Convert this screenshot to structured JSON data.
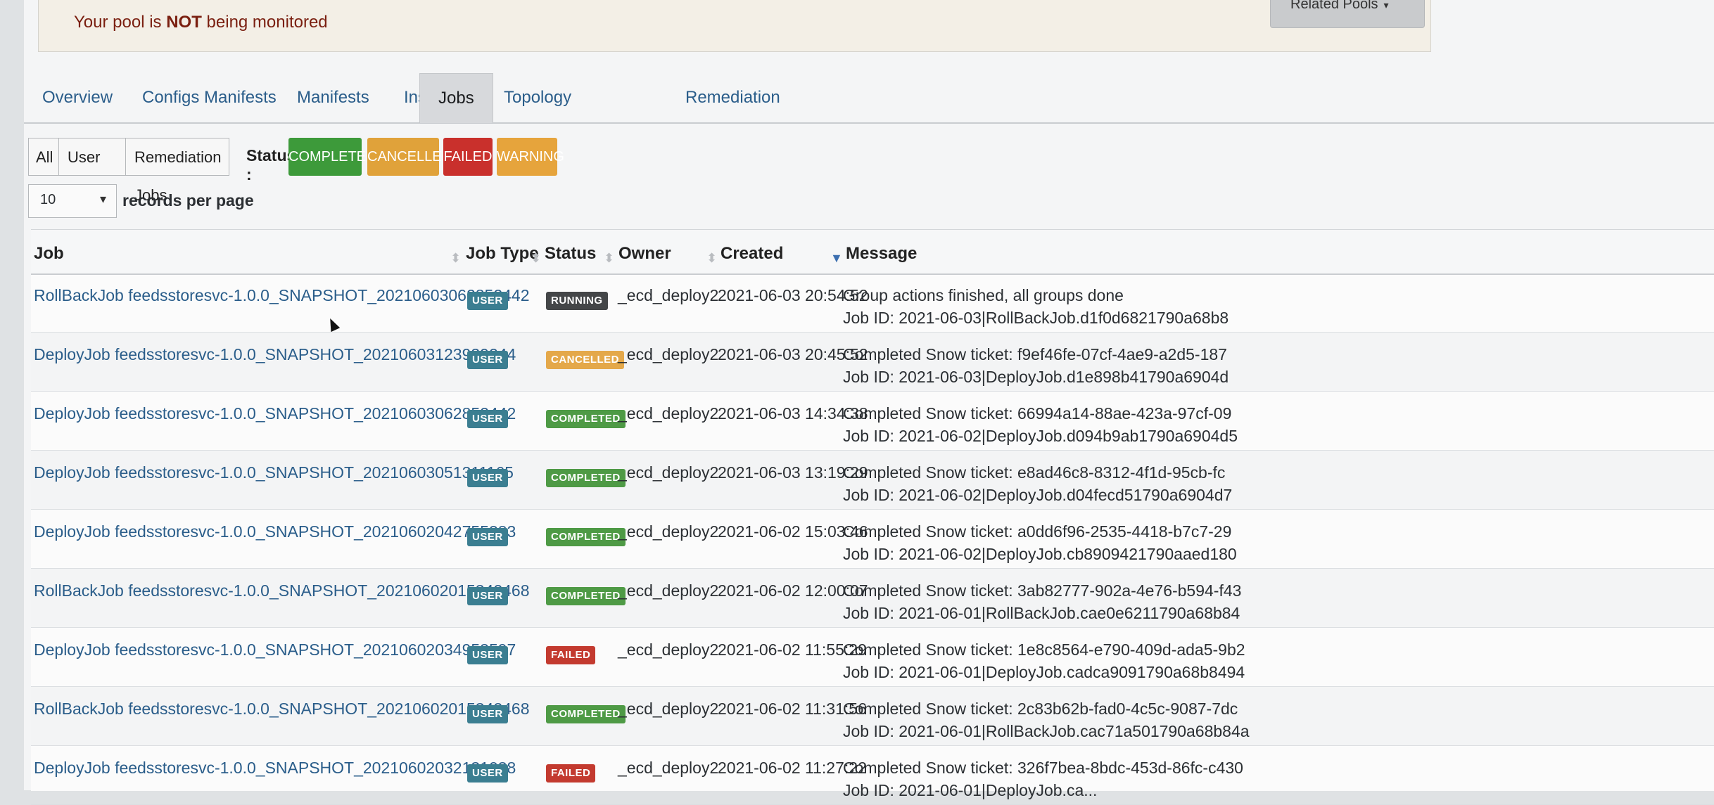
{
  "alert": {
    "prefix": "Your pool is ",
    "strong": "NOT",
    "suffix": " being monitored"
  },
  "related_pools": {
    "label": "Related Pools"
  },
  "tabs": [
    {
      "label": "Overview"
    },
    {
      "label": "Configs Manifests"
    },
    {
      "label": "Manifests"
    },
    {
      "label": "Instances"
    },
    {
      "label": "Topology"
    },
    {
      "label": "Jobs",
      "active": true
    },
    {
      "label": "Remediation"
    }
  ],
  "filters": {
    "all": "All",
    "user_jobs": "User Jobs",
    "remediation_jobs": "Remediation Jobs",
    "status_label": "Status :",
    "statuses": [
      {
        "label": "COMPLETED",
        "color": "#3d9a3a"
      },
      {
        "label": "CANCELLED",
        "color": "#e0a23a"
      },
      {
        "label": "FAILED",
        "color": "#c9302c"
      },
      {
        "label": "WARNING",
        "color": "#e6a43c"
      }
    ]
  },
  "pager": {
    "value": "10",
    "label": "records per page"
  },
  "table": {
    "headers": {
      "job": "Job",
      "job_type": "Job Type",
      "status": "Status",
      "owner": "Owner",
      "created": "Created",
      "message": "Message"
    },
    "badge_colors": {
      "USER": "#3b7e91",
      "RUNNING": "#444648",
      "CANCELLED": "#e4a84a",
      "COMPLETED": "#4e9a45",
      "FAILED": "#c33a2f"
    },
    "rows": [
      {
        "job": "RollBackJob feedsstoresvc-1.0.0_SNAPSHOT_20210603062852442",
        "type": "USER",
        "status": "RUNNING",
        "owner": "_ecd_deploy2",
        "created": "2021-06-03 20:54:52",
        "msg1": "Group actions finished, all groups done",
        "msg2": "Job ID: 2021-06-03|RollBackJob.d1f0d6821790a68b8"
      },
      {
        "job": "DeployJob feedsstoresvc-1.0.0_SNAPSHOT_20210603123939244",
        "type": "USER",
        "status": "CANCELLED",
        "owner": "_ecd_deploy2",
        "created": "2021-06-03 20:45:52",
        "msg1": "Completed Snow ticket: f9ef46fe-07cf-4ae9-a2d5-187",
        "msg2": "Job ID: 2021-06-03|DeployJob.d1e898b41790a6904d"
      },
      {
        "job": "DeployJob feedsstoresvc-1.0.0_SNAPSHOT_20210603062852442",
        "type": "USER",
        "status": "COMPLETED",
        "owner": "_ecd_deploy2",
        "created": "2021-06-03 14:34:38",
        "msg1": "Completed Snow ticket: 66994a14-88ae-423a-97cf-09",
        "msg2": "Job ID: 2021-06-02|DeployJob.d094b9ab1790a6904d5"
      },
      {
        "job": "DeployJob feedsstoresvc-1.0.0_SNAPSHOT_20210603051311165",
        "type": "USER",
        "status": "COMPLETED",
        "owner": "_ecd_deploy2",
        "created": "2021-06-03 13:19:29",
        "msg1": "Completed Snow ticket: e8ad46c8-8312-4f1d-95cb-fc",
        "msg2": "Job ID: 2021-06-02|DeployJob.d04fecd51790a6904d7"
      },
      {
        "job": "DeployJob feedsstoresvc-1.0.0_SNAPSHOT_20210602042755383",
        "type": "USER",
        "status": "COMPLETED",
        "owner": "_ecd_deploy2",
        "created": "2021-06-02 15:03:46",
        "msg1": "Completed Snow ticket: a0dd6f96-2535-4418-b7c7-29",
        "msg2": "Job ID: 2021-06-02|DeployJob.cb8909421790aaed180"
      },
      {
        "job": "RollBackJob feedsstoresvc-1.0.0_SNAPSHOT_20210602015342468",
        "type": "USER",
        "status": "COMPLETED",
        "owner": "_ecd_deploy2",
        "created": "2021-06-02 12:00:07",
        "msg1": "Completed Snow ticket: 3ab82777-902a-4e76-b594-f43",
        "msg2": "Job ID: 2021-06-01|RollBackJob.cae0e6211790a68b84"
      },
      {
        "job": "DeployJob feedsstoresvc-1.0.0_SNAPSHOT_20210602034953597",
        "type": "USER",
        "status": "FAILED",
        "owner": "_ecd_deploy2",
        "created": "2021-06-02 11:55:29",
        "msg1": "Completed Snow ticket: 1e8c8564-e790-409d-ada5-9b2",
        "msg2": "Job ID: 2021-06-01|DeployJob.cadca9091790a68b8494"
      },
      {
        "job": "RollBackJob feedsstoresvc-1.0.0_SNAPSHOT_20210602015342468",
        "type": "USER",
        "status": "COMPLETED",
        "owner": "_ecd_deploy2",
        "created": "2021-06-02 11:31:56",
        "msg1": "Completed Snow ticket: 2c83b62b-fad0-4c5c-9087-7dc",
        "msg2": "Job ID: 2021-06-01|RollBackJob.cac71a501790a68b84a"
      },
      {
        "job": "DeployJob feedsstoresvc-1.0.0_SNAPSHOT_20210602032131038",
        "type": "USER",
        "status": "FAILED",
        "owner": "_ecd_deploy2",
        "created": "2021-06-02 11:27:22",
        "msg1": "Completed Snow ticket: 326f7bea-8bdc-453d-86fc-c430",
        "msg2": "Job ID: 2021-06-01|DeployJob.ca..."
      }
    ]
  }
}
